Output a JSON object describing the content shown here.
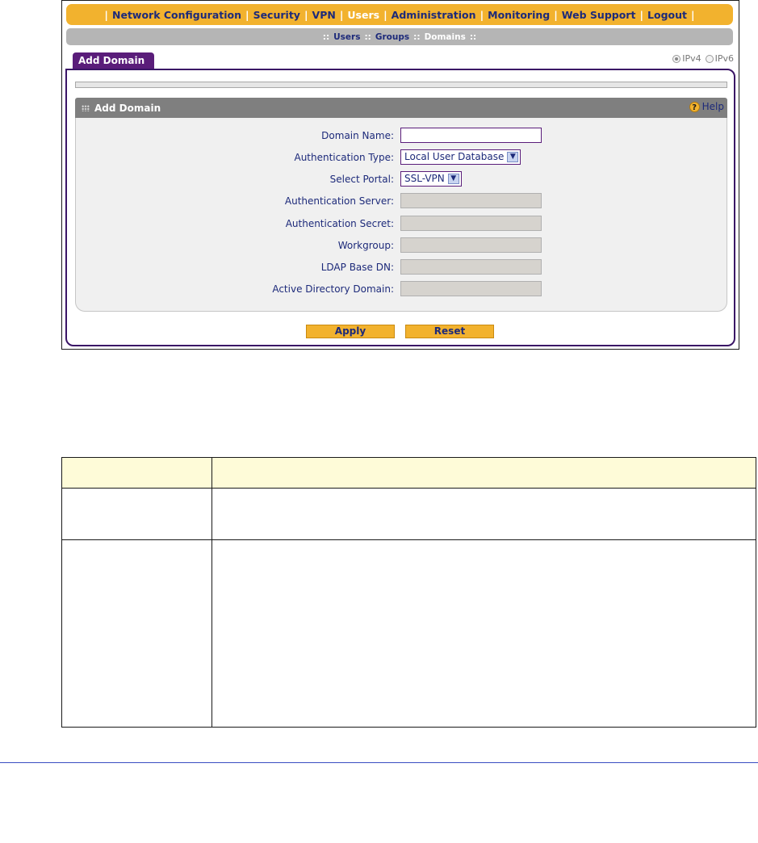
{
  "topnav": {
    "items": [
      "Network Configuration",
      "Security",
      "VPN",
      "Users",
      "Administration",
      "Monitoring",
      "Web Support",
      "Logout"
    ],
    "active_index": 3
  },
  "subnav": {
    "items": [
      "Users",
      "Groups",
      "Domains"
    ],
    "active_index": 2
  },
  "tab": {
    "label": "Add Domain"
  },
  "ip_mode": {
    "options": [
      "IPv4",
      "IPv6"
    ],
    "selected": "IPv4"
  },
  "section": {
    "title": "Add Domain",
    "help_label": "Help"
  },
  "form": {
    "domain_name": {
      "label": "Domain Name:",
      "value": ""
    },
    "authentication_type": {
      "label": "Authentication Type:",
      "value": "Local User Database"
    },
    "select_portal": {
      "label": "Select Portal:",
      "value": "SSL-VPN"
    },
    "authentication_server": {
      "label": "Authentication Server:",
      "value": ""
    },
    "authentication_secret": {
      "label": "Authentication Secret:",
      "value": ""
    },
    "workgroup": {
      "label": "Workgroup:",
      "value": ""
    },
    "ldap_base_dn": {
      "label": "LDAP Base DN:",
      "value": ""
    },
    "active_directory_domain": {
      "label": "Active Directory Domain:",
      "value": ""
    }
  },
  "buttons": {
    "apply": "Apply",
    "reset": "Reset"
  },
  "colors": {
    "nav_orange": "#f2b22e",
    "nav_text": "#1d2a7a",
    "tab_purple": "#5a1d7a",
    "panel_border": "#3a1566",
    "section_grey": "#7f7f7f",
    "table_header": "#fefbd8",
    "footer_rule": "#3a4ec2"
  }
}
